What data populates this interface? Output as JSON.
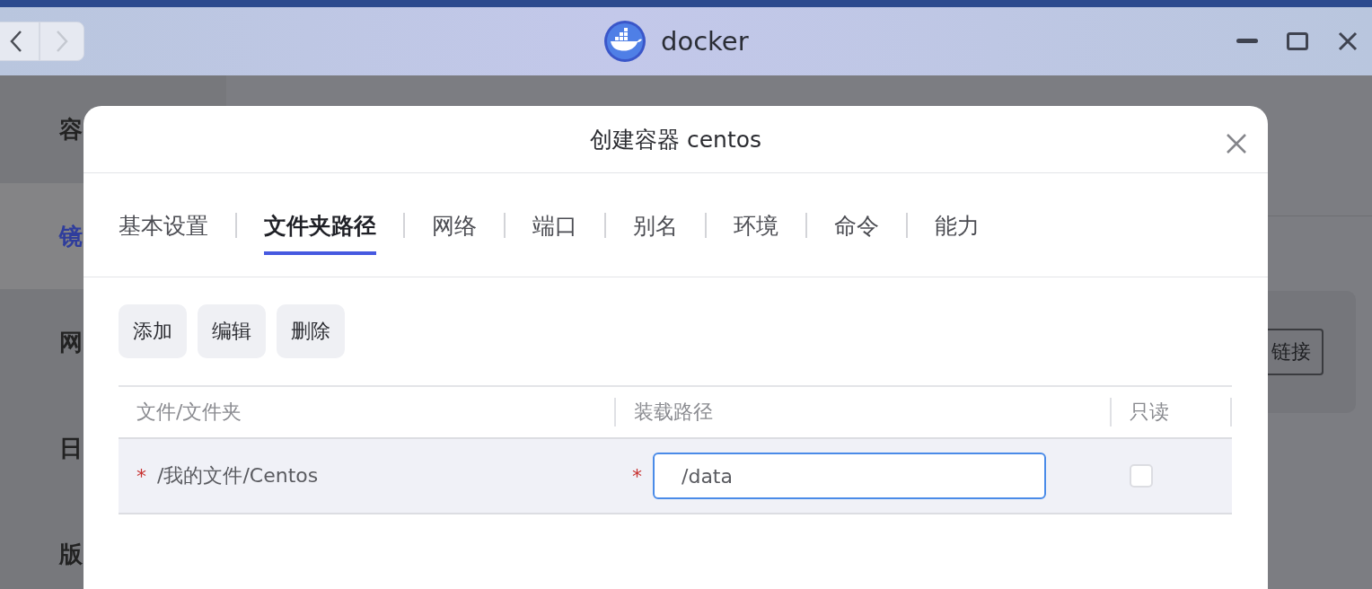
{
  "window": {
    "title": "docker",
    "back_disabled": false,
    "forward_disabled": true
  },
  "sidebar": {
    "items": [
      {
        "label": "容",
        "selected": false
      },
      {
        "label": "镜",
        "selected": true
      },
      {
        "label": "网",
        "selected": false
      },
      {
        "label": "日",
        "selected": false
      },
      {
        "label": "版",
        "selected": false
      }
    ]
  },
  "background_card": {
    "button": "链接"
  },
  "dialog": {
    "title": "创建容器 centos",
    "tabs": [
      {
        "label": "基本设置",
        "selected": false
      },
      {
        "label": "文件夹路径",
        "selected": true
      },
      {
        "label": "网络",
        "selected": false
      },
      {
        "label": "端口",
        "selected": false
      },
      {
        "label": "别名",
        "selected": false
      },
      {
        "label": "环境",
        "selected": false
      },
      {
        "label": "命令",
        "selected": false
      },
      {
        "label": "能力",
        "selected": false
      }
    ],
    "actions": [
      "添加",
      "编辑",
      "删除"
    ],
    "table": {
      "columns": [
        "文件/文件夹",
        "装载路径",
        "只读"
      ],
      "rows": [
        {
          "required_mark": "*",
          "file": "/我的文件/Centos",
          "mount_mark": "*",
          "mount_path": "/data",
          "read_only": false
        }
      ]
    }
  }
}
